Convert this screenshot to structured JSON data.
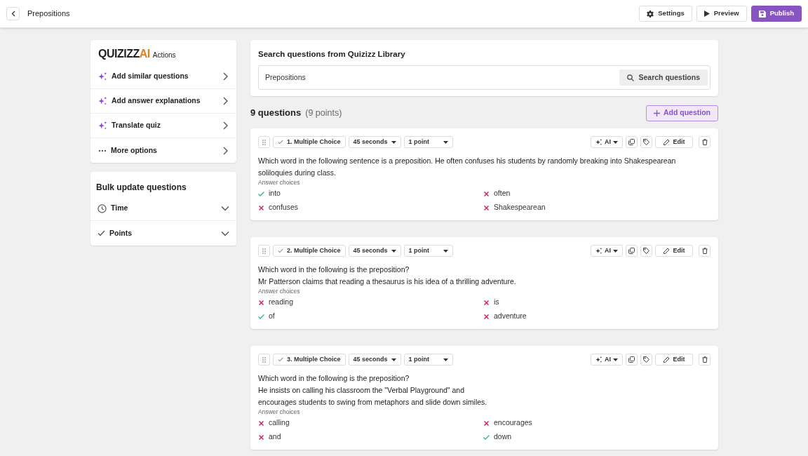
{
  "header": {
    "title": "Prepositions",
    "buttons": [
      {
        "kind": "settings",
        "label": "Settings"
      },
      {
        "kind": "preview",
        "label": "Preview"
      },
      {
        "kind": "publish",
        "label": "Publish"
      }
    ]
  },
  "ai_actions": {
    "logo": "QUIZIZZ",
    "logo_suffix": "AI",
    "title": "Actions",
    "items": [
      {
        "kind": "ai",
        "label": "Add similar questions"
      },
      {
        "kind": "ai",
        "label": "Add answer explanations"
      },
      {
        "kind": "ai",
        "label": "Translate quiz"
      },
      {
        "kind": "more",
        "label": "More options"
      }
    ]
  },
  "bulk_update": {
    "title": "Bulk update questions",
    "items": [
      {
        "kind": "time",
        "label": "Time"
      },
      {
        "kind": "points",
        "label": "Points"
      }
    ]
  },
  "library_search": {
    "title": "Search questions from Quizizz Library",
    "value": "Prepositions",
    "button": "Search questions"
  },
  "summary": {
    "count": "9 questions",
    "points": "(9 points)",
    "add_button": "Add question"
  },
  "questions": [
    {
      "type": "1. Multiple Choice",
      "time": "45 seconds",
      "points": "1 point",
      "ai": "AI",
      "edit": "Edit",
      "lines": [
        "Which word in the following sentence is a preposition. He often confuses his students by randomly breaking into Shakespearean soliloquies during class."
      ],
      "answers_label": "Answer choices",
      "answers": [
        {
          "text": "into",
          "correct": true
        },
        {
          "text": "often",
          "correct": false
        },
        {
          "text": "confuses",
          "correct": false
        },
        {
          "text": "Shakespearean",
          "correct": false
        }
      ]
    },
    {
      "type": "2. Multiple Choice",
      "time": "45 seconds",
      "points": "1 point",
      "ai": "AI",
      "edit": "Edit",
      "lines": [
        "Which word in the following is the preposition?",
        "Mr Patterson claims that reading a thesaurus is his idea of a thrilling adventure."
      ],
      "answers_label": "Answer choices",
      "answers": [
        {
          "text": "reading",
          "correct": false
        },
        {
          "text": "is",
          "correct": false
        },
        {
          "text": "of",
          "correct": true
        },
        {
          "text": "adventure",
          "correct": false
        }
      ]
    },
    {
      "type": "3. Multiple Choice",
      "time": "45 seconds",
      "points": "1 point",
      "ai": "AI",
      "edit": "Edit",
      "lines": [
        "Which word in the following is the preposition?",
        "He insists on calling his classroom the \"Verbal Playground\" and",
        "encourages students to swing from metaphors and slide down similes."
      ],
      "answers_label": "Answer choices",
      "answers": [
        {
          "text": "calling",
          "correct": false
        },
        {
          "text": "encourages",
          "correct": false
        },
        {
          "text": "and",
          "correct": false
        },
        {
          "text": "down",
          "correct": true
        }
      ]
    }
  ]
}
